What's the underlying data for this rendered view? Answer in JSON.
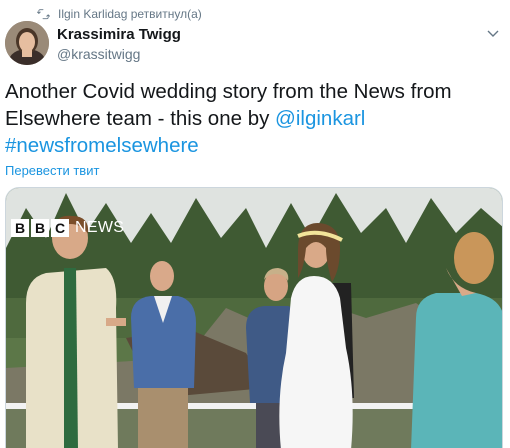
{
  "retweet": {
    "label": "Ilgin Karlidag ретвитнул(а)",
    "icon": "retweet-icon"
  },
  "author": {
    "display_name": "Krassimira Twigg",
    "handle": "@krassitwigg"
  },
  "tweet": {
    "text_before": "Another Covid wedding story from the News from Elsewhere team - this one by ",
    "mention": "@ilginkarl",
    "hashtag": "#newsfromelsewhere"
  },
  "translate_label": "Перевести твит",
  "media": {
    "overlay_brand": "BBC",
    "overlay_brand_letters": [
      "B",
      "B",
      "C"
    ],
    "overlay_news": "NEWS",
    "overlay_color": "#bb1919"
  },
  "colors": {
    "link": "#1b95e0",
    "secondary_text": "#657786",
    "primary_text": "#14171a"
  }
}
